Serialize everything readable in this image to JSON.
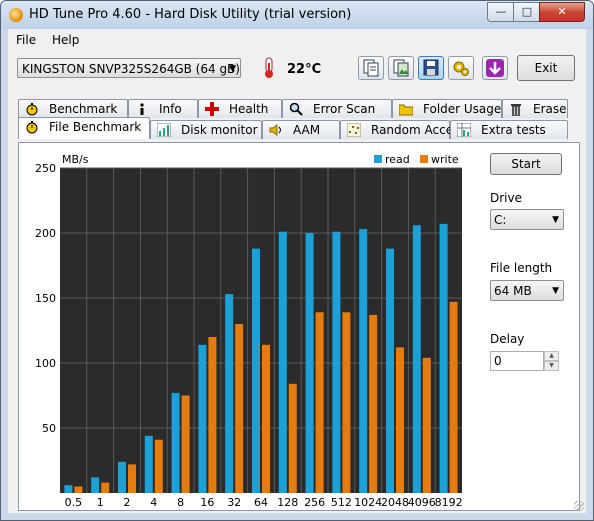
{
  "window": {
    "title": "HD Tune Pro 4.60 - Hard Disk Utility (trial version)"
  },
  "menu": [
    "File",
    "Help"
  ],
  "toolbar": {
    "drive": "KINGSTON SNVP325S264GB (64 gB)",
    "temperature": "22°C",
    "exit_label": "Exit"
  },
  "tabs_top": [
    "Benchmark",
    "Info",
    "Health",
    "Error Scan",
    "Folder Usage",
    "Erase"
  ],
  "tabs_bottom": [
    "File Benchmark",
    "Disk monitor",
    "AAM",
    "Random Access",
    "Extra tests"
  ],
  "selected_tab": "File Benchmark",
  "side": {
    "start_label": "Start",
    "drive_label": "Drive",
    "drive_value": "C:",
    "file_length_label": "File length",
    "file_length_value": "64 MB",
    "delay_label": "Delay",
    "delay_value": "0"
  },
  "colors": {
    "read": "#1ba1d8",
    "write": "#e67c0e",
    "plot_bg": "#2b2b2b",
    "grid": "#595959"
  },
  "chart_data": {
    "type": "bar",
    "ylabel": "MB/s",
    "ylim": [
      0,
      250
    ],
    "yticks": [
      50,
      100,
      150,
      200,
      250
    ],
    "categories": [
      "0.5",
      "1",
      "2",
      "4",
      "8",
      "16",
      "32",
      "64",
      "128",
      "256",
      "512",
      "1024",
      "2048",
      "4096",
      "8192"
    ],
    "series": [
      {
        "name": "read",
        "values": [
          6,
          12,
          24,
          44,
          77,
          114,
          153,
          188,
          201,
          200,
          201,
          203,
          188,
          206,
          207
        ]
      },
      {
        "name": "write",
        "values": [
          5,
          8,
          22,
          41,
          75,
          120,
          130,
          114,
          84,
          139,
          139,
          137,
          112,
          104,
          147
        ]
      }
    ]
  }
}
